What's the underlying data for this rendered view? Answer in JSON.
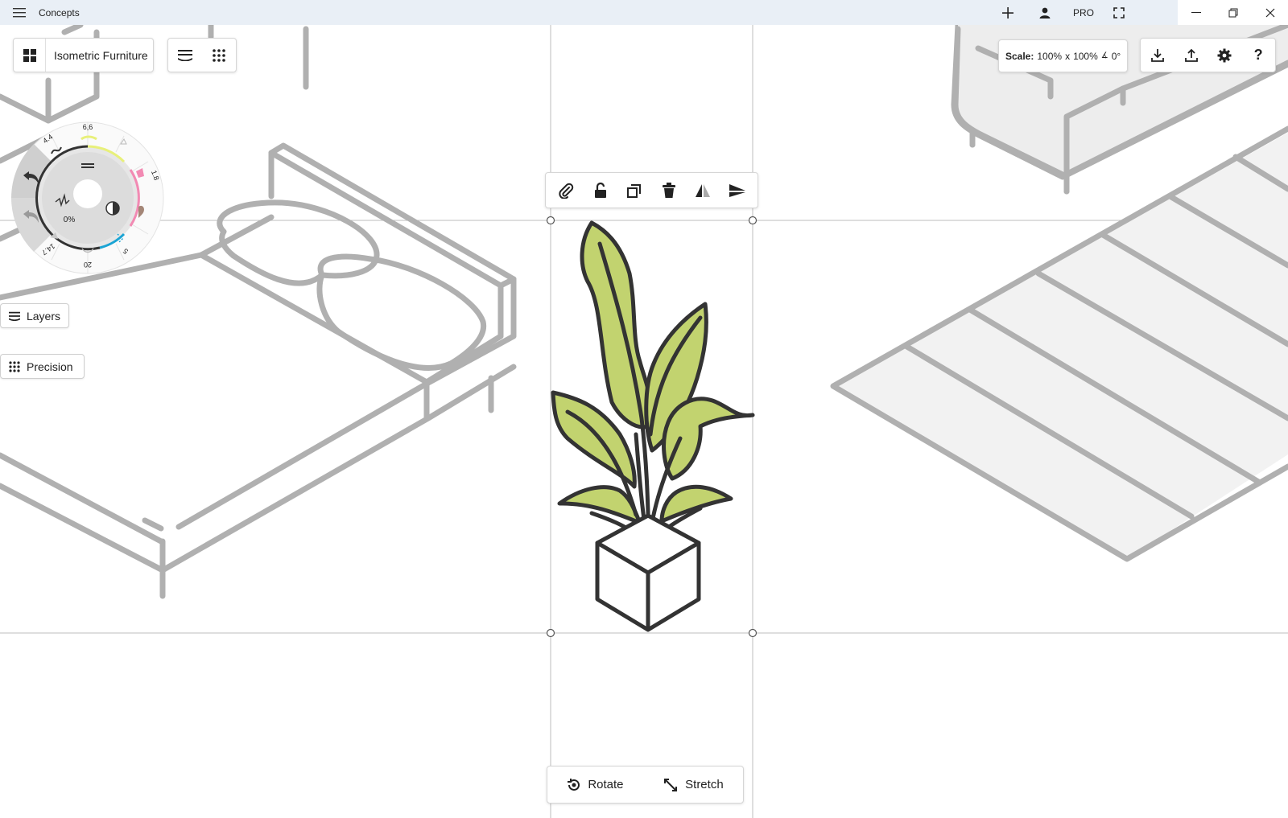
{
  "titlebar": {
    "app_title": "Concepts",
    "pro_label": "PRO"
  },
  "project": {
    "name": "Isometric Furniture"
  },
  "scale": {
    "label": "Scale:",
    "x_value": "100%",
    "separator": "x",
    "y_value": "100%",
    "angle": "0°"
  },
  "side_buttons": {
    "layers": "Layers",
    "precision": "Precision"
  },
  "tool_wheel": {
    "size_top": "6,6",
    "size_top_left": "4.4",
    "size_right": "1.8",
    "size_bottom_right": "5",
    "size_bottom": "20",
    "size_bottom_left": "14.7",
    "opacity": "0%"
  },
  "selection_toolbar": {
    "items": [
      "paperclip-icon",
      "lock-icon",
      "duplicate-icon",
      "delete-icon",
      "flip-icon",
      "align-icon"
    ]
  },
  "transform": {
    "rotate_label": "Rotate",
    "stretch_label": "Stretch"
  },
  "colors": {
    "titlebar_bg": "#e9eff6",
    "line_gray": "#b0b0b0",
    "leaf_green": "#c2d36f",
    "stroke_dark": "#333333"
  }
}
